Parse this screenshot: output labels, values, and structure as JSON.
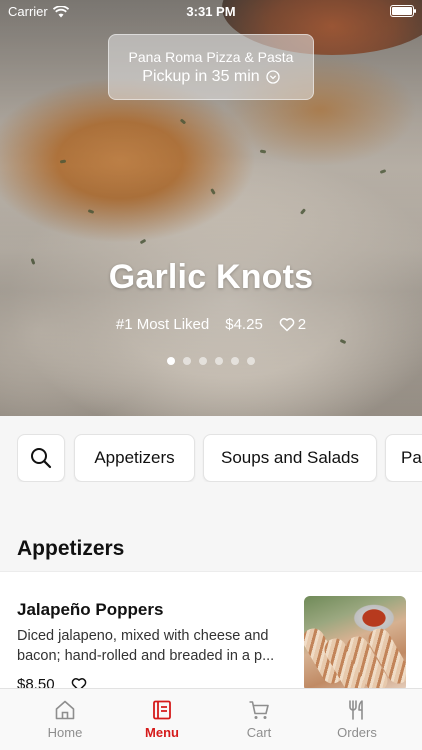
{
  "status_bar": {
    "carrier": "Carrier",
    "time": "3:31 PM"
  },
  "pickup": {
    "restaurant": "Pana Roma Pizza & Pasta",
    "eta": "Pickup in 35 min"
  },
  "hero": {
    "title": "Garlic Knots",
    "badge": "#1 Most Liked",
    "price": "$4.25",
    "likes": "2",
    "slides": 6,
    "active_slide": 1
  },
  "categories": [
    "Appetizers",
    "Soups and Salads",
    "Pa"
  ],
  "section": {
    "title": "Appetizers"
  },
  "item": {
    "name": "Jalapeño Poppers",
    "description_line1": "Diced jalapeno, mixed with cheese and",
    "description_line2": "bacon; hand-rolled and breaded in a p...",
    "price": "$8.50"
  },
  "tabs": [
    {
      "label": "Home",
      "icon": "home-icon",
      "active": false
    },
    {
      "label": "Menu",
      "icon": "menu-icon",
      "active": true
    },
    {
      "label": "Cart",
      "icon": "cart-icon",
      "active": false
    },
    {
      "label": "Orders",
      "icon": "utensils-icon",
      "active": false
    }
  ],
  "colors": {
    "accent": "#d51b1b",
    "inactive": "#8e8e8e",
    "background": "#f6f6f6"
  }
}
